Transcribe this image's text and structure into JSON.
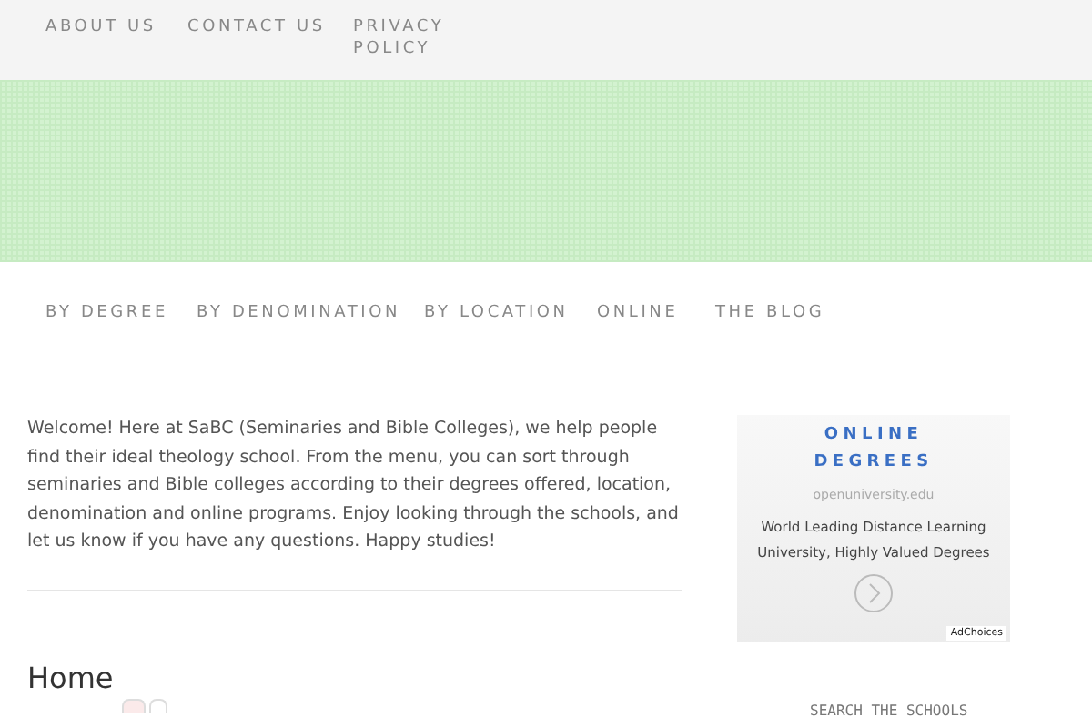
{
  "top_nav": [
    "ABOUT US",
    "CONTACT US",
    "PRIVACY POLICY"
  ],
  "main_nav": [
    "BY DEGREE",
    "BY DENOMINATION",
    "BY LOCATION",
    "ONLINE",
    "THE BLOG"
  ],
  "intro": "Welcome! Here at SaBC (Seminaries and Bible Colleges), we help people find their ideal theology school. From the menu, you can sort through seminaries and Bible colleges according to their degrees offered, location, denomination and online programs. Enjoy looking through the schools, and let us know if you have any questions. Happy studies!",
  "ad": {
    "title": "ONLINE DEGREES",
    "domain": "openuniversity.edu",
    "text": "World Leading Distance Learning University, Highly Valued Degrees",
    "badge": "AdChoices"
  },
  "page_title": "Home",
  "sidebar_heading": "SEARCH THE SCHOOLS"
}
